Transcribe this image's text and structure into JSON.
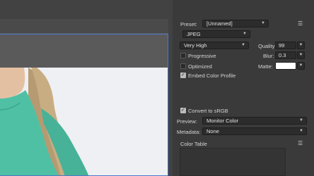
{
  "settings": {
    "preset_label": "Preset:",
    "preset_value": "[Unnamed]",
    "format_value": "JPEG",
    "compression_value": "Very High",
    "quality_label": "Quality:",
    "quality_value": "99",
    "blur_label": "Blur:",
    "blur_value": "0.3",
    "matte_label": "Matte:",
    "matte_color": "#ffffff",
    "progressive_label": "Progressive",
    "progressive_checked": false,
    "optimized_label": "Optimized",
    "optimized_checked": false,
    "embed_profile_label": "Embed Color Profile",
    "embed_profile_checked": true
  },
  "color": {
    "convert_srgb_label": "Convert to sRGB",
    "convert_srgb_checked": true,
    "preview_label": "Preview:",
    "preview_value": "Monitor Color",
    "metadata_label": "Metadata:",
    "metadata_value": "None"
  },
  "color_table": {
    "title": "Color Table"
  },
  "icons": {
    "menu": "menu-lines-icon",
    "dropdown": "chevron-down-icon"
  },
  "colors": {
    "selection_border": "#4d78c8",
    "panel_bg": "#3a3a3a",
    "shirt": "#4fc0a4"
  }
}
